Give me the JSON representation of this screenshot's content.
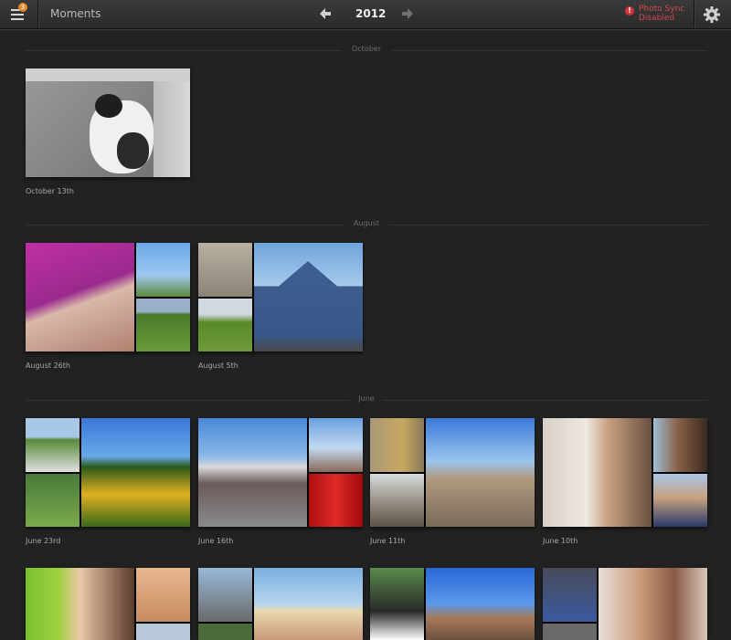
{
  "toolbar": {
    "menu_badge": "3",
    "title": "Moments",
    "year": "2012",
    "sync_status_line1": "Photo Sync",
    "sync_status_line2": "Disabled",
    "sync_icon_glyph": "!"
  },
  "sections": {
    "october": "October",
    "august": "August",
    "june": "June"
  },
  "moments": {
    "oct13": "October 13th",
    "aug26": "August 26th",
    "aug5": "August 5th",
    "jun23": "June 23rd",
    "jun16": "June 16th",
    "jun11": "June 11th",
    "jun10": "June 10th"
  },
  "colors": {
    "background": "#222222",
    "toolbar": "#333333",
    "badge": "#e08a2a",
    "sync_warning": "#d04a4a"
  },
  "icons": {
    "menu": "hamburger-icon",
    "prev": "arrow-left-icon",
    "next": "arrow-right-icon",
    "sync": "alert-icon",
    "settings": "gear-icon"
  }
}
